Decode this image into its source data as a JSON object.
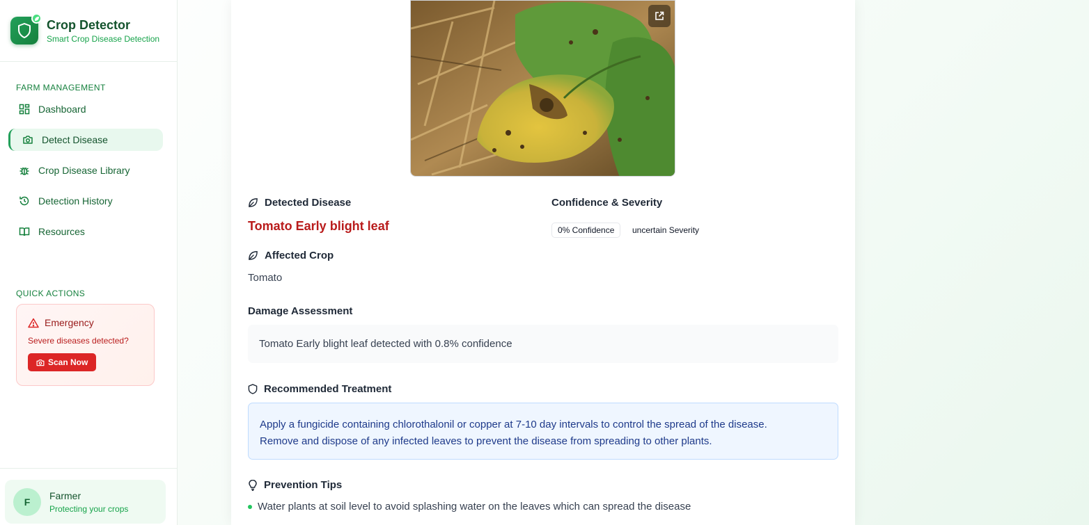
{
  "brand": {
    "title": "Crop Detector",
    "subtitle": "Smart Crop Disease Detection"
  },
  "sidebar": {
    "section_label": "FARM MANAGEMENT",
    "items": [
      {
        "label": "Dashboard",
        "icon": "dashboard-icon"
      },
      {
        "label": "Detect Disease",
        "icon": "camera-icon",
        "active": true
      },
      {
        "label": "Crop Disease Library",
        "icon": "bug-icon"
      },
      {
        "label": "Detection History",
        "icon": "history-icon"
      },
      {
        "label": "Resources",
        "icon": "book-icon"
      }
    ],
    "quick_actions_label": "QUICK ACTIONS",
    "emergency": {
      "title": "Emergency",
      "text": "Severe diseases detected?",
      "button": "Scan Now"
    },
    "user": {
      "initial": "F",
      "name": "Farmer",
      "subtitle": "Protecting your crops"
    }
  },
  "result": {
    "detected_label": "Detected Disease",
    "disease_name": "Tomato Early blight leaf",
    "confidence_label": "Confidence & Severity",
    "confidence_badge": "0% Confidence",
    "severity_badge": "uncertain Severity",
    "affected_label": "Affected Crop",
    "affected_crop": "Tomato",
    "damage_label": "Damage Assessment",
    "damage_text": "Tomato Early blight leaf detected with 0.8% confidence",
    "treatment_label": "Recommended Treatment",
    "treatment_line1": "Apply a fungicide containing chlorothalonil or copper at 7-10 day intervals to control the spread of the disease.",
    "treatment_line2": "Remove and dispose of any infected leaves to prevent the disease from spreading to other plants.",
    "prevention_label": "Prevention Tips",
    "prevention_tips": [
      "Water plants at soil level to avoid splashing water on the leaves which can spread the disease"
    ]
  },
  "colors": {
    "brand_green": "#15803d",
    "disease_red": "#b91c1c",
    "emergency_red": "#dc2626",
    "treatment_blue": "#1e3a8a"
  }
}
